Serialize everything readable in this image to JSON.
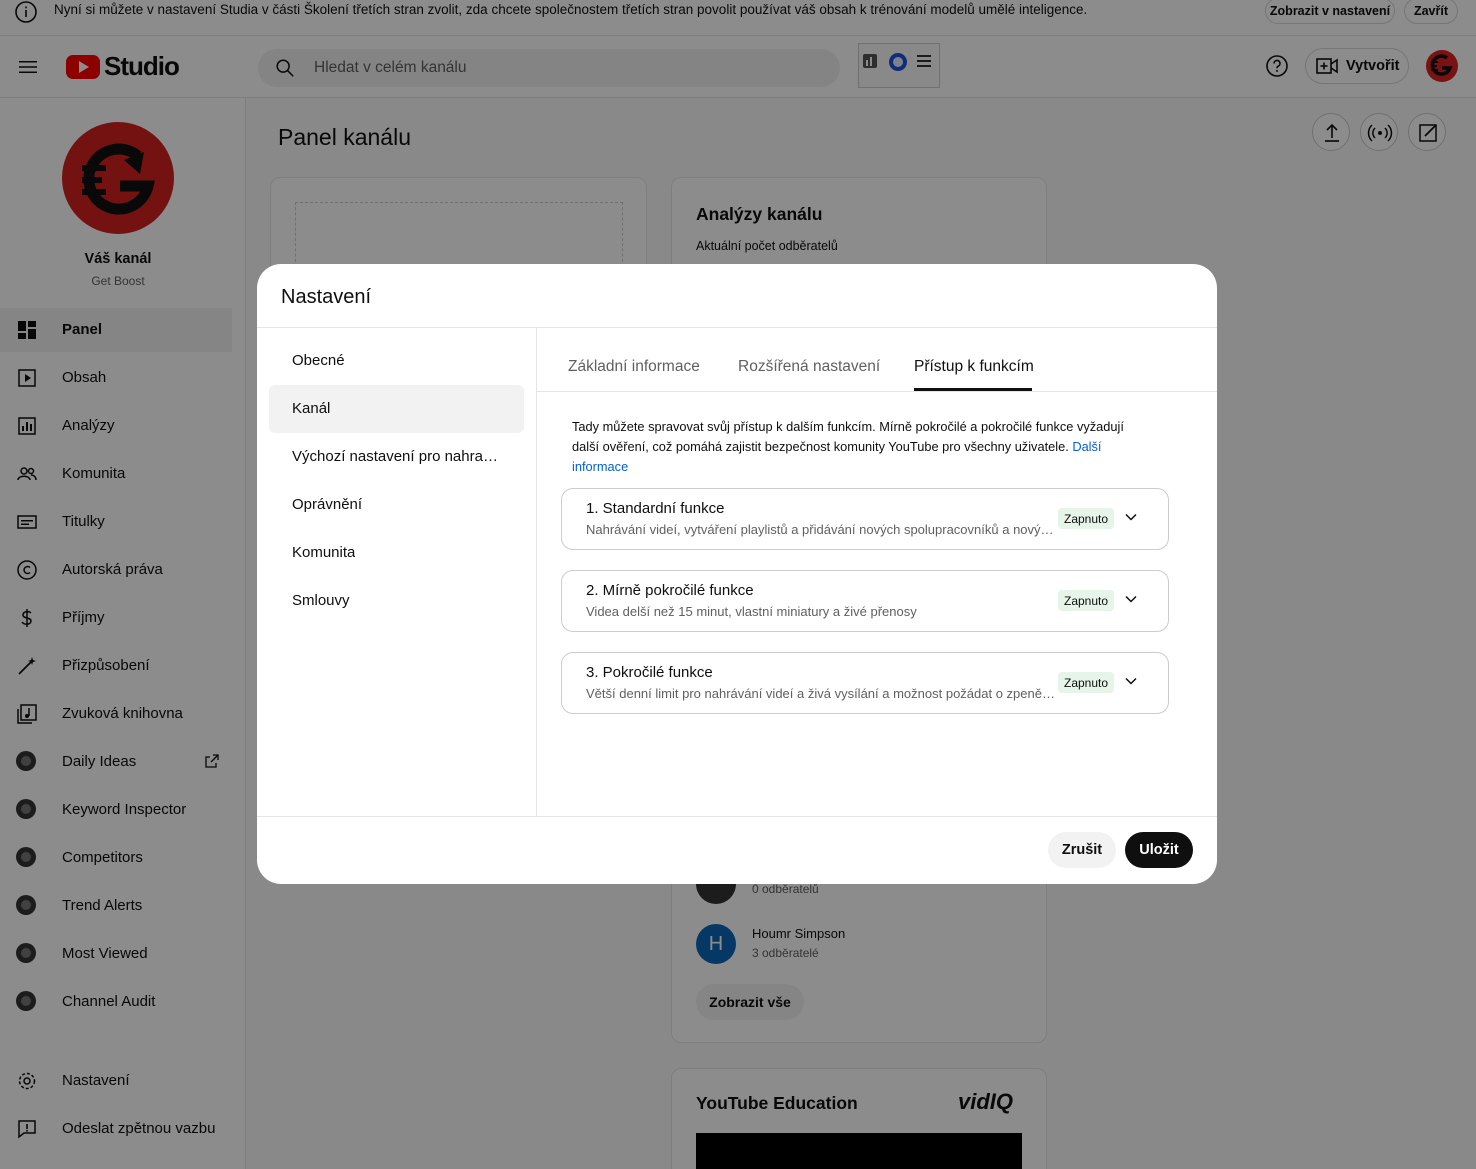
{
  "banner": {
    "text": "Nyní si můžete v nastavení Studia v části Školení třetích stran zvolit, zda chcete společnostem třetích stran povolit používat váš obsah k trénování modelů umělé inteligence.",
    "view_settings_label": "Zobrazit v nastavení",
    "close_label": "Zavřít"
  },
  "header": {
    "logo_text": "Studio",
    "search_placeholder": "Hledat v celém kanálu",
    "create_label": "Vytvořit"
  },
  "sidebar": {
    "channel_title": "Váš kanál",
    "channel_subtitle": "Get Boost",
    "items": [
      {
        "label": "Panel",
        "icon": "dashboard-icon"
      },
      {
        "label": "Obsah",
        "icon": "content-icon"
      },
      {
        "label": "Analýzy",
        "icon": "analytics-icon"
      },
      {
        "label": "Komunita",
        "icon": "community-icon"
      },
      {
        "label": "Titulky",
        "icon": "subtitles-icon"
      },
      {
        "label": "Autorská práva",
        "icon": "copyright-icon"
      },
      {
        "label": "Příjmy",
        "icon": "earn-icon"
      },
      {
        "label": "Přizpůsobení",
        "icon": "customization-icon"
      },
      {
        "label": "Zvuková knihovna",
        "icon": "audio-library-icon"
      },
      {
        "label": "Daily Ideas",
        "icon": "vidiq-icon"
      },
      {
        "label": "Keyword Inspector",
        "icon": "vidiq-icon"
      },
      {
        "label": "Competitors",
        "icon": "vidiq-icon"
      },
      {
        "label": "Trend Alerts",
        "icon": "vidiq-icon"
      },
      {
        "label": "Most Viewed",
        "icon": "vidiq-icon"
      },
      {
        "label": "Channel Audit",
        "icon": "vidiq-icon"
      }
    ],
    "settings_label": "Nastavení",
    "feedback_label": "Odeslat zpětnou vazbu"
  },
  "main": {
    "page_title": "Panel kanálu",
    "analytics_card": {
      "title": "Analýzy kanálu",
      "subtitle": "Aktuální počet odběratelů"
    },
    "subscribers": [
      {
        "initial": "",
        "name": "",
        "count": "0 odběratelů"
      },
      {
        "initial": "H",
        "name": "Houmr Simpson",
        "count": "3 odběratelé"
      }
    ],
    "show_all_label": "Zobrazit vše",
    "education_card": {
      "title": "YouTube Education",
      "brand": "vidIQ"
    }
  },
  "modal": {
    "title": "Nastavení",
    "categories": [
      "Obecné",
      "Kanál",
      "Výchozí nastavení pro nahrané video",
      "Oprávnění",
      "Komunita",
      "Smlouvy"
    ],
    "active_category": "Kanál",
    "tabs": [
      "Základní informace",
      "Rozšířená nastavení",
      "Přístup k funkcím"
    ],
    "active_tab": "Přístup k funkcím",
    "description": "Tady můžete spravovat svůj přístup k dalším funkcím. Mírně pokročilé a pokročilé funkce vyžadují další ověření, což pomáhá zajistit bezpečnost komunity YouTube pro všechny uživatele.",
    "more_info_label": "Další informace",
    "features": [
      {
        "title": "1. Standardní funkce",
        "description": "Nahrávání videí, vytváření playlistů a přidávání nových spolupracovníků a nových uživatelů",
        "status": "Zapnuto"
      },
      {
        "title": "2. Mírně pokročilé funkce",
        "description": "Videa delší než 15 minut, vlastní miniatury a živé přenosy",
        "status": "Zapnuto"
      },
      {
        "title": "3. Pokročilé funkce",
        "description": "Větší denní limit pro nahrávání videí a živá vysílání a možnost požádat o zpeněžení",
        "status": "Zapnuto"
      }
    ],
    "cancel_label": "Zrušit",
    "save_label": "Uložit"
  },
  "colors": {
    "accent": "#065fd4",
    "brand_red": "#ff0000",
    "status_bg": "#e6f4ea"
  }
}
